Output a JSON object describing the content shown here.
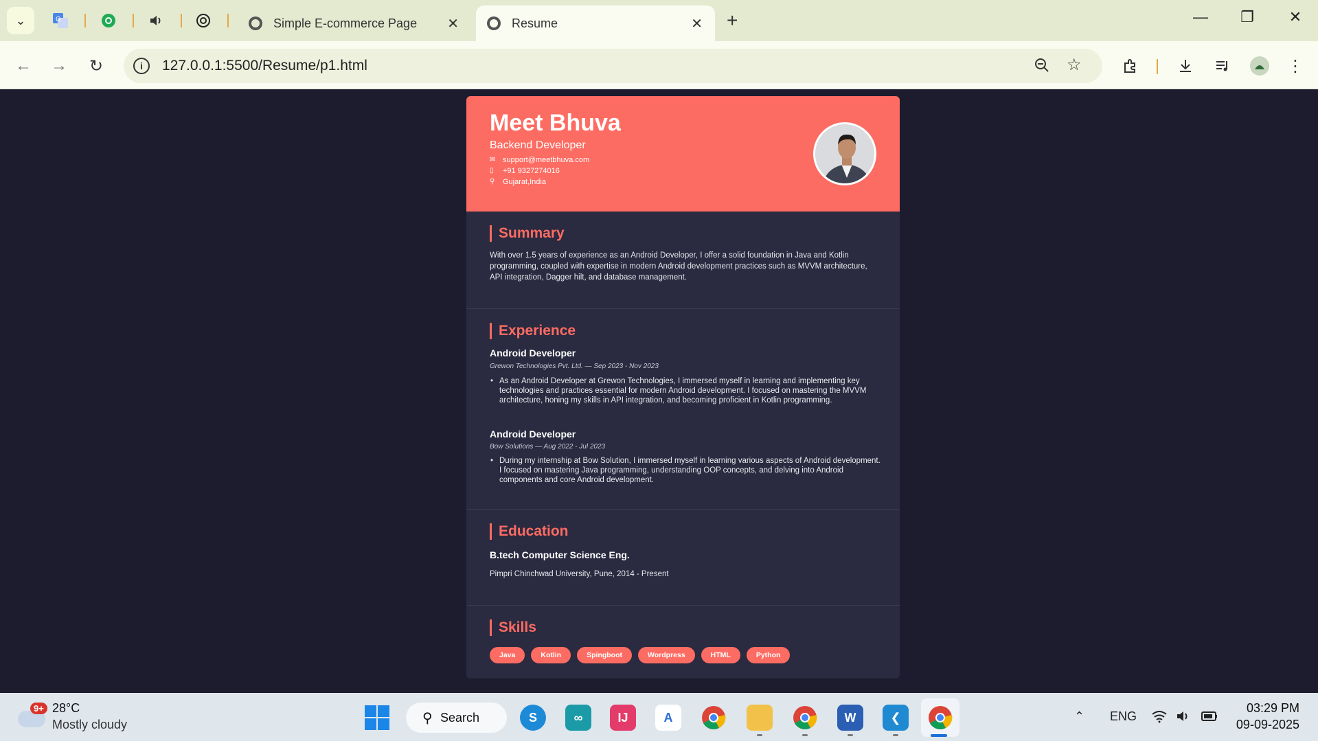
{
  "browser": {
    "tabs": [
      {
        "title": "Simple E-commerce Page",
        "active": false
      },
      {
        "title": "Resume",
        "active": true
      }
    ],
    "url": "127.0.0.1:5500/Resume/p1.html"
  },
  "resume": {
    "name": "Meet Bhuva",
    "role": "Backend Developer",
    "email": "support@meetbhuva.com",
    "phone": "+91 9327274016",
    "location": "Gujarat,India",
    "summary": {
      "title": "Summary",
      "text": "With over 1.5 years of experience as an Android Developer, I offer a solid foundation in Java and Kotlin programming, coupled with expertise in modern Android development practices such as MVVM architecture, API integration, Dagger hilt, and database management."
    },
    "experience": {
      "title": "Experience",
      "jobs": [
        {
          "title": "Android Developer",
          "meta": "Grewon Technologies Pvt. Ltd. — Sep 2023 - Nov 2023",
          "bullet": "As an Android Developer at Grewon Technologies, I immersed myself in learning and implementing key technologies and practices essential for modern Android development. I focused on mastering the MVVM architecture, honing my skills in API integration, and becoming proficient in Kotlin programming."
        },
        {
          "title": "Android Developer",
          "meta": "Bow Solutions — Aug 2022 - Jul 2023",
          "bullet": "During my internship at Bow Solution, I immersed myself in learning various aspects of Android development. I focused on mastering Java programming, understanding OOP concepts, and delving into Android components and core Android development."
        }
      ]
    },
    "education": {
      "title": "Education",
      "degree": "B.tech Computer Science Eng.",
      "meta": "Pimpri Chinchwad University, Pune, 2014 - Present"
    },
    "skills": {
      "title": "Skills",
      "items": [
        "Java",
        "Kotlin",
        "Spingboot",
        "Wordpress",
        "HTML",
        "Python"
      ]
    }
  },
  "taskbar": {
    "weather_badge": "9+",
    "temperature": "28°C",
    "weather_desc": "Mostly cloudy",
    "search_label": "Search",
    "language": "ENG",
    "time": "03:29 PM",
    "date": "09-09-2025"
  },
  "colors": {
    "accent": "#fd6c62",
    "page_bg": "#1c1c2e",
    "card_bg": "#2a2a40"
  }
}
